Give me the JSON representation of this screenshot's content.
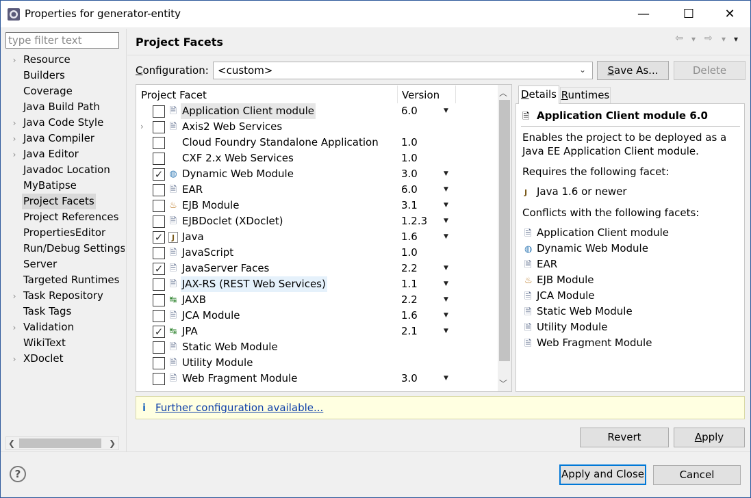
{
  "window": {
    "title": "Properties for generator-entity",
    "minimize": "—",
    "maximize": "☐",
    "close": "✕"
  },
  "filter": {
    "placeholder": "type filter text"
  },
  "nav": [
    {
      "label": "Resource",
      "expandable": true
    },
    {
      "label": "Builders",
      "expandable": false
    },
    {
      "label": "Coverage",
      "expandable": false
    },
    {
      "label": "Java Build Path",
      "expandable": false
    },
    {
      "label": "Java Code Style",
      "expandable": true
    },
    {
      "label": "Java Compiler",
      "expandable": true
    },
    {
      "label": "Java Editor",
      "expandable": true
    },
    {
      "label": "Javadoc Location",
      "expandable": false
    },
    {
      "label": "MyBatipse",
      "expandable": false
    },
    {
      "label": "Project Facets",
      "expandable": false,
      "selected": true
    },
    {
      "label": "Project References",
      "expandable": false
    },
    {
      "label": "PropertiesEditor",
      "expandable": false
    },
    {
      "label": "Run/Debug Settings",
      "expandable": false
    },
    {
      "label": "Server",
      "expandable": false
    },
    {
      "label": "Targeted Runtimes",
      "expandable": false
    },
    {
      "label": "Task Repository",
      "expandable": true
    },
    {
      "label": "Task Tags",
      "expandable": false
    },
    {
      "label": "Validation",
      "expandable": true
    },
    {
      "label": "WikiText",
      "expandable": false
    },
    {
      "label": "XDoclet",
      "expandable": true
    }
  ],
  "page": {
    "title": "Project Facets",
    "back_arrow": "⇦",
    "forward_arrow": "⇨",
    "menu_arrow": "▾"
  },
  "config": {
    "label_prefix": "C",
    "label_rest": "onfiguration:",
    "value": "<custom>",
    "save_as_prefix": "S",
    "save_as_rest": "ave As...",
    "delete": "Delete"
  },
  "table": {
    "col_facet": "Project Facet",
    "col_version": "Version",
    "rows": [
      {
        "name": "Application Client module",
        "version": "6.0",
        "checked": false,
        "dropdown": true,
        "icon": "page-icon",
        "highlight": "gray"
      },
      {
        "name": "Axis2 Web Services",
        "version": "",
        "checked": false,
        "dropdown": false,
        "icon": "page-icon",
        "expander": true
      },
      {
        "name": "Cloud Foundry Standalone Application",
        "version": "1.0",
        "checked": false,
        "dropdown": false,
        "icon": "none"
      },
      {
        "name": "CXF 2.x Web Services",
        "version": "1.0",
        "checked": false,
        "dropdown": false,
        "icon": "none"
      },
      {
        "name": "Dynamic Web Module",
        "version": "3.0",
        "checked": true,
        "dropdown": true,
        "icon": "globe-icon"
      },
      {
        "name": "EAR",
        "version": "6.0",
        "checked": false,
        "dropdown": true,
        "icon": "page-icon"
      },
      {
        "name": "EJB Module",
        "version": "3.1",
        "checked": false,
        "dropdown": true,
        "icon": "bean-icon"
      },
      {
        "name": "EJBDoclet (XDoclet)",
        "version": "1.2.3",
        "checked": false,
        "dropdown": true,
        "icon": "page-icon"
      },
      {
        "name": "Java",
        "version": "1.6",
        "checked": true,
        "dropdown": true,
        "icon": "java-icon"
      },
      {
        "name": "JavaScript",
        "version": "1.0",
        "checked": false,
        "dropdown": false,
        "icon": "page-icon"
      },
      {
        "name": "JavaServer Faces",
        "version": "2.2",
        "checked": true,
        "dropdown": true,
        "icon": "page-icon"
      },
      {
        "name": "JAX-RS (REST Web Services)",
        "version": "1.1",
        "checked": false,
        "dropdown": true,
        "icon": "page-icon",
        "highlight": "blue"
      },
      {
        "name": "JAXB",
        "version": "2.2",
        "checked": false,
        "dropdown": true,
        "icon": "jaxb-icon"
      },
      {
        "name": "JCA Module",
        "version": "1.6",
        "checked": false,
        "dropdown": true,
        "icon": "page-icon"
      },
      {
        "name": "JPA",
        "version": "2.1",
        "checked": true,
        "dropdown": true,
        "icon": "jpa-icon"
      },
      {
        "name": "Static Web Module",
        "version": "",
        "checked": false,
        "dropdown": false,
        "icon": "page-icon"
      },
      {
        "name": "Utility Module",
        "version": "",
        "checked": false,
        "dropdown": false,
        "icon": "page-icon"
      },
      {
        "name": "Web Fragment Module",
        "version": "3.0",
        "checked": false,
        "dropdown": true,
        "icon": "page-icon"
      }
    ]
  },
  "details": {
    "tab_details_prefix": "D",
    "tab_details_rest": "etails",
    "tab_runtimes_prefix": "R",
    "tab_runtimes_rest": "untimes",
    "title": "Application Client module 6.0",
    "desc_line1": "Enables the project to be deployed as a",
    "desc_line2": "Java EE Application Client module.",
    "requires_heading": "Requires the following facet:",
    "requires": [
      {
        "label": "Java 1.6 or newer",
        "icon": "java-icon"
      }
    ],
    "conflicts_heading": "Conflicts with the following facets:",
    "conflicts": [
      {
        "label": "Application Client module",
        "icon": "page-icon"
      },
      {
        "label": "Dynamic Web Module",
        "icon": "globe-icon"
      },
      {
        "label": "EAR",
        "icon": "page-icon"
      },
      {
        "label": "EJB Module",
        "icon": "bean-icon"
      },
      {
        "label": "JCA Module",
        "icon": "page-icon"
      },
      {
        "label": "Static Web Module",
        "icon": "page-icon"
      },
      {
        "label": "Utility Module",
        "icon": "page-icon"
      },
      {
        "label": "Web Fragment Module",
        "icon": "page-icon"
      }
    ]
  },
  "info": {
    "link": "Further configuration available..."
  },
  "buttons": {
    "revert": "Revert",
    "apply_prefix": "A",
    "apply_rest": "pply",
    "apply_and_close": "Apply and Close",
    "cancel": "Cancel",
    "help": "?"
  },
  "icons": {
    "page-icon": "🗎",
    "globe-icon": "◍",
    "bean-icon": "♨",
    "java-icon": "J",
    "jaxb-icon": "↹",
    "jpa-icon": "↹",
    "none": ""
  }
}
